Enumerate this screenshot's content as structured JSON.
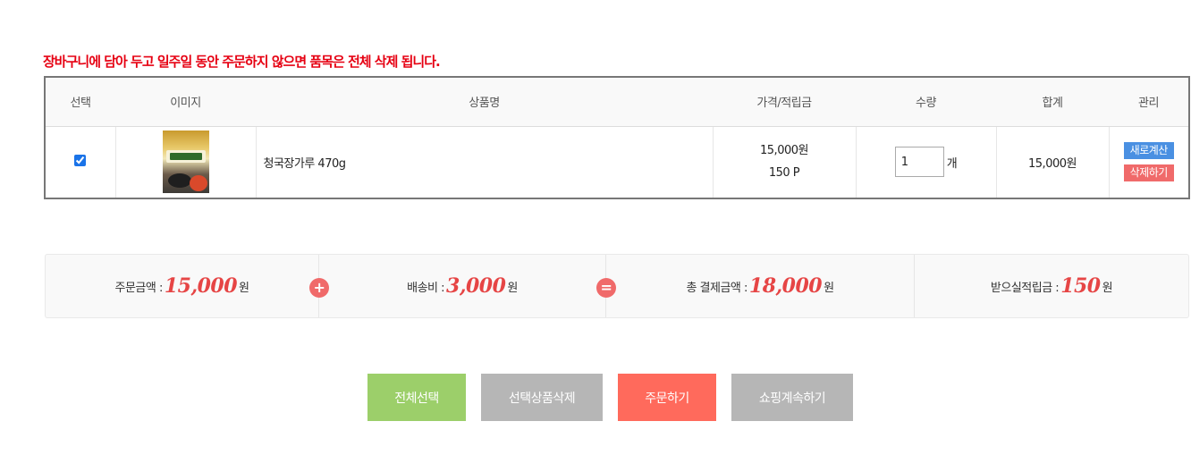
{
  "notice": "장바구니에 담아 두고 일주일 동안 주문하지 않으면 품목은 전체 삭제 됩니다.",
  "table": {
    "headers": [
      "선택",
      "이미지",
      "상품명",
      "가격/적립금",
      "수량",
      "합계",
      "관리"
    ],
    "rows": [
      {
        "selected": true,
        "name": "청국장가루 470g",
        "price": "15,000원",
        "points": "150 P",
        "quantity": "1",
        "unit": "개",
        "total": "15,000원",
        "recalc_label": "새로계산",
        "delete_label": "삭제하기"
      }
    ]
  },
  "summary": {
    "order_amount_label": "주문금액 : ",
    "order_amount_value": "15,000",
    "shipping_label": "배송비 : ",
    "shipping_value": "3,000",
    "total_label": "총 결제금액 : ",
    "total_value": "18,000",
    "points_label": "받으실적립금 : ",
    "points_value": "150",
    "currency": "원",
    "plus_symbol": "+",
    "equals_symbol": "="
  },
  "actions": {
    "select_all": "전체선택",
    "delete_selected": "선택상품삭제",
    "order": "주문하기",
    "continue_shopping": "쇼핑계속하기"
  },
  "colors": {
    "notice": "#e60012",
    "amount": "#e64545",
    "select_all_btn": "#9ccf6a",
    "gray_btn": "#b6b6b6",
    "order_btn": "#ff6a5c",
    "recalc_btn": "#4a90e2",
    "delete_btn": "#f06a6a"
  }
}
